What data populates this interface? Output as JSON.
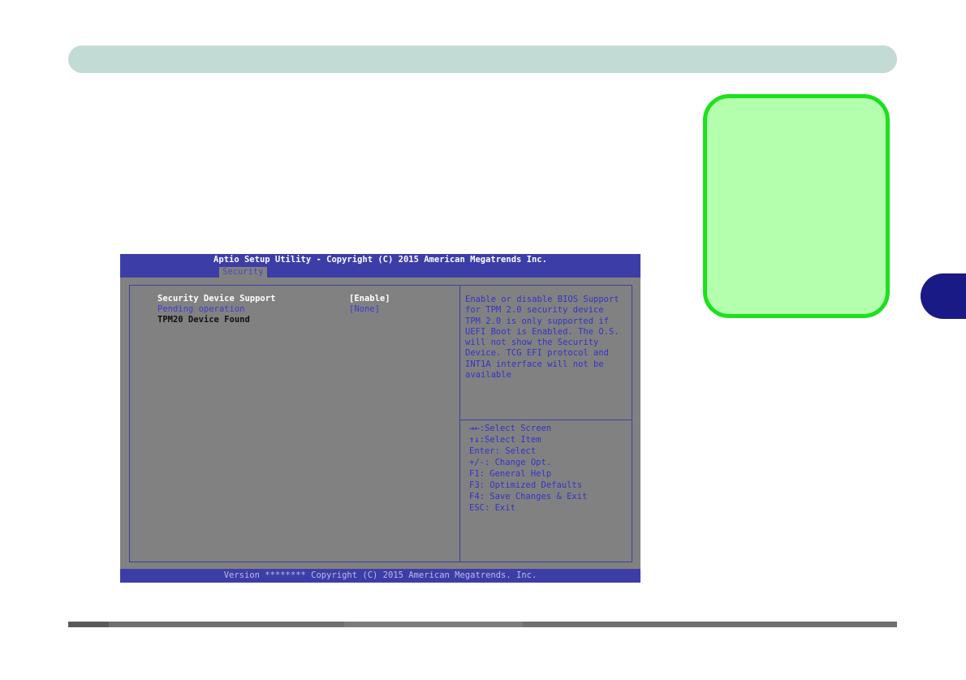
{
  "chapter_tab": {
    "label": ""
  },
  "bios": {
    "title": "Aptio Setup Utility - Copyright (C) 2015 American Megatrends Inc.",
    "active_tab": "Security",
    "options": [
      {
        "label": "Security Device Support",
        "value": "[Enable]"
      },
      {
        "label": "Pending operation",
        "value": "[None]"
      },
      {
        "label": "TPM20 Device Found",
        "value": ""
      }
    ],
    "help": "Enable or disable BIOS Support\nfor TPM 2.0 security device\nTPM 2.0 is only supported if\nUEFI Boot is Enabled. The O.S.\nwill not show the Security\nDevice. TCG EFI protocol and\nINT1A interface will not be\navailable",
    "keys": [
      {
        "arrow": "→←",
        "text": ":Select Screen"
      },
      {
        "arrow": "↑↓",
        "text": ":Select Item"
      },
      {
        "arrow": "",
        "text": "Enter: Select"
      },
      {
        "arrow": "",
        "text": "+/-: Change Opt."
      },
      {
        "arrow": "",
        "text": "F1: General Help"
      },
      {
        "arrow": "",
        "text": "F3: Optimized Defaults"
      },
      {
        "arrow": "",
        "text": "F4: Save Changes & Exit"
      },
      {
        "arrow": "",
        "text": "ESC: Exit"
      }
    ],
    "version": "Version ******** Copyright (C) 2015 American Megatrends. Inc."
  },
  "colors": {
    "header_bar": "#c3dbd5",
    "note_fill": "#b3ffae",
    "note_border": "#1ee01e",
    "chapter_tab": "#1a1a86",
    "bios_blue": "#3d3da8",
    "bios_gray": "#818181"
  }
}
